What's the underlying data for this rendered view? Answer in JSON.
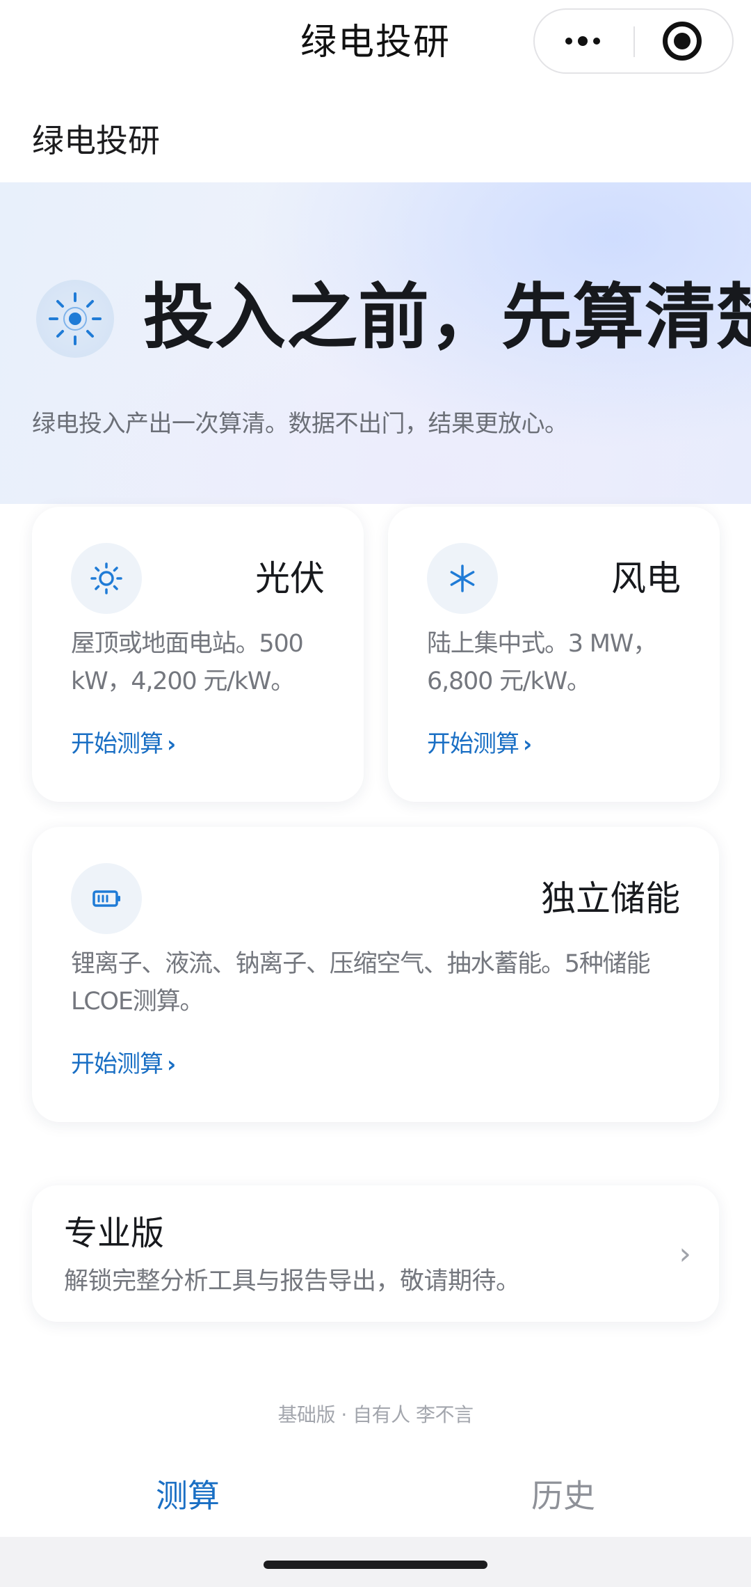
{
  "navbar": {
    "title": "绿电投研",
    "more_icon": "more-dots-icon",
    "close_icon": "target-circle-icon"
  },
  "page_title": "绿电投研",
  "hero": {
    "icon": "sun-icon",
    "headline": "投入之前，先算清楚。",
    "description": "绿电投入产出一次算清。数据不出门，结果更放心。"
  },
  "cards": [
    {
      "title": "光伏",
      "icon": "sun-icon",
      "desc_line1": "屋顶或地面电站。500",
      "desc_line2": "kW，4,200 元/kW。",
      "link": "开始测算",
      "chevron": "›"
    },
    {
      "title": "风电",
      "icon": "asterisk-icon",
      "desc_line1": "陆上集中式。3 MW，",
      "desc_line2": "6,800 元/kW。",
      "link": "开始测算",
      "chevron": "›"
    },
    {
      "title": "独立储能",
      "icon": "battery-icon",
      "desc_line1": "锂离子、液流、钠离子、压缩空气、抽水蓄能。5种储能",
      "desc_line2": "LCOE测算。",
      "link": "开始测算",
      "chevron": "›"
    }
  ],
  "pro": {
    "title": "专业版",
    "description": "解锁完整分析工具与报告导出，敬请期待。",
    "chevron": "›"
  },
  "footer_note": "基础版 · 自有人 李不言",
  "tabs": [
    {
      "label": "测算",
      "active": true
    },
    {
      "label": "历史",
      "active": false
    }
  ],
  "colors": {
    "accent": "#1a6fc4",
    "hero_bg": "#e8effb",
    "text_primary": "#17191d",
    "text_secondary": "#74777e",
    "tab_inactive": "#8e9198"
  }
}
